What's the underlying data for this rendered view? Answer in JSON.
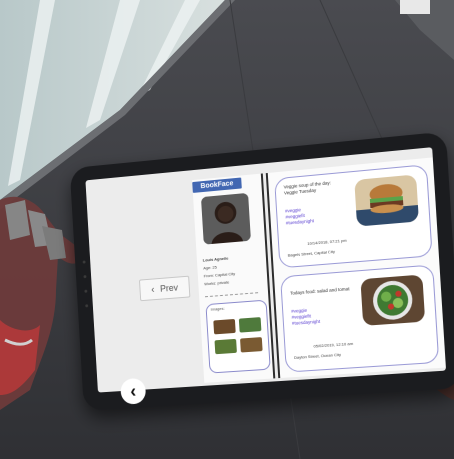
{
  "app": {
    "brand": "BookFace"
  },
  "nav": {
    "prev_label": "Prev",
    "prev_icon": "chevron-left-icon",
    "back_icon": "back-arrow-icon"
  },
  "profile": {
    "name": "Louis Agnelle",
    "age_line": "Age:  25",
    "from_line": "From:  Capital City",
    "works_line": "Works:  private",
    "images_label": "Images:"
  },
  "posts": [
    {
      "text": "Veggie soup of the day: Veggie Tuesday",
      "tags": [
        "#veggie",
        "#veggiefit",
        "#tuesdaynight"
      ],
      "date": "10/14/2018, 07:21 pm",
      "location": "Bagels Street, Capital City"
    },
    {
      "text": "Todays food: salad and tomat",
      "tags": [
        "#veggie",
        "#veggiefit",
        "#tuesdaynight"
      ],
      "date": "05/02/2019, 12:10 am",
      "location": "Dayton Street, Ocean City"
    }
  ],
  "colors": {
    "brand": "#4267b2",
    "card_border": "#9a9ad6",
    "tag": "#5a3fd1"
  }
}
